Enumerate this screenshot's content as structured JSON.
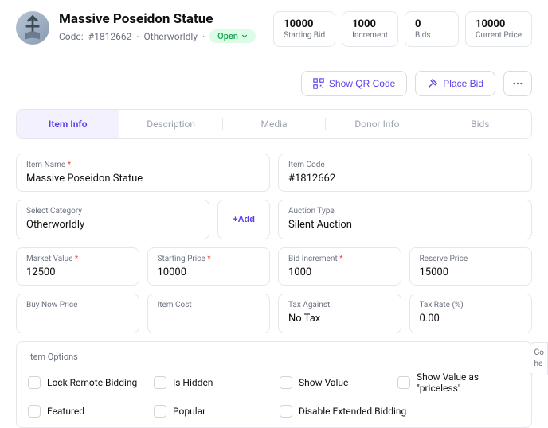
{
  "header": {
    "title": "Massive Poseidon Statue",
    "code_prefix": "Code:",
    "code": "#1812662",
    "category": "Otherworldly",
    "status": "Open"
  },
  "stats": [
    {
      "value": "10000",
      "label": "Starting Bid"
    },
    {
      "value": "1000",
      "label": "Increment"
    },
    {
      "value": "0",
      "label": "Bids"
    },
    {
      "value": "10000",
      "label": "Current Price"
    }
  ],
  "actions": {
    "show_qr": "Show QR Code",
    "place_bid": "Place Bid"
  },
  "tabs": [
    "Item Info",
    "Description",
    "Media",
    "Donor Info",
    "Bids"
  ],
  "form": {
    "item_name": {
      "label": "Item Name",
      "value": "Massive Poseidon Statue",
      "required": true
    },
    "item_code": {
      "label": "Item Code",
      "value": "#1812662"
    },
    "category": {
      "label": "Select Category",
      "value": "Otherworldly"
    },
    "add_button": "+Add",
    "auction_type": {
      "label": "Auction Type",
      "value": "Silent Auction"
    },
    "market_value": {
      "label": "Market Value",
      "value": "12500",
      "required": true
    },
    "starting_price": {
      "label": "Starting Price",
      "value": "10000",
      "required": true
    },
    "bid_increment": {
      "label": "Bid Increment",
      "value": "1000",
      "required": true
    },
    "reserve_price": {
      "label": "Reserve Price",
      "value": "15000"
    },
    "buy_now": {
      "label": "Buy Now Price",
      "value": ""
    },
    "item_cost": {
      "label": "Item Cost",
      "value": ""
    },
    "tax_against": {
      "label": "Tax Against",
      "value": "No Tax"
    },
    "tax_rate": {
      "label": "Tax Rate (%)",
      "value": "0.00"
    }
  },
  "options": {
    "title": "Item Options",
    "items": [
      "Lock Remote Bidding",
      "Is Hidden",
      "Show Value",
      "Show Value as \"priceless\"",
      "Featured",
      "Popular",
      "Disable Extended Bidding"
    ]
  },
  "side_peek": [
    "Go",
    "he"
  ]
}
